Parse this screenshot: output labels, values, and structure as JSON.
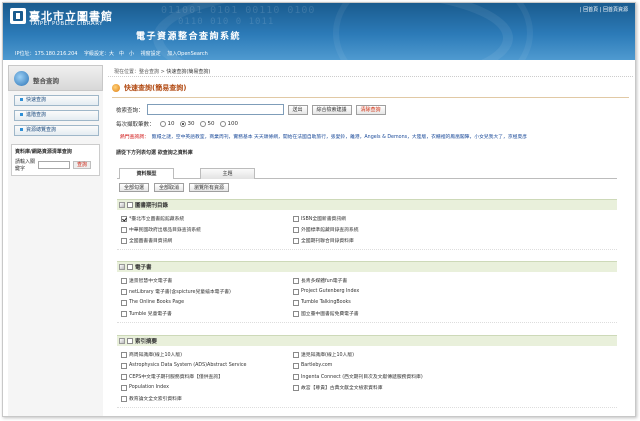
{
  "header": {
    "library_cn": "臺北市立圖書館",
    "library_en": "TAIPEI PUBLIC LIBRARY",
    "system_title": "電子資源整合查詢系統",
    "top_links": "| 回首頁 | 回首頁資源",
    "ip_label": "IP位址：175.180.216.204",
    "font_size": "字級設定：大　中　小",
    "resize": "視窗設定",
    "opensearch": "加入OpenSearch",
    "bg_digits": "011001 0101 00110 0100",
    "bg_digits2": "0110 010 0 1011"
  },
  "sidebar": {
    "title": "整合查詢",
    "items": [
      "快速查詢",
      "進階查詢",
      "資源總覽查詢"
    ],
    "box_title": "資料庫/網路資源清單查詢",
    "box_label": "請輸入關鍵字",
    "box_button": "查詢"
  },
  "main": {
    "breadcrumb_label": "現在位置：整合查詢 > ",
    "breadcrumb_current": "快速查詢(簡易查詢)",
    "section_title": "快速查詢(簡易查詢)",
    "search_label": "檢索查詢：",
    "btn_submit": "送出",
    "btn_suggest": "綜合檢索建議",
    "btn_clear": "清除查詢",
    "count_label": "每次擷取筆數：",
    "count_options": [
      "10",
      "30",
      "50",
      "100"
    ],
    "count_selected": "30",
    "hot_label": "熱門查詢詞：",
    "hot_words": "甄嬛之謎，空中英語教室，商業周刊，實務基本 天天頭條網，開始在法國自助旅行，張愛鈴，離港，Angels & Demons，大陸版，衣櫃裡的鳳凰閣陣，小女兒我大了，京極夏彥",
    "pick_label": "請從下方列表勾選 欲查詢之資料庫",
    "tabs": [
      "資料類型",
      "主題"
    ],
    "actions": [
      "全部勾選",
      "全部取消",
      "瀏覽所有資源"
    ]
  },
  "groups": [
    {
      "title": "圖書期刊目錄",
      "items": [
        {
          "label": "*臺北市立圖書館館藏系統",
          "checked": true
        },
        {
          "label": "ISBN全國新書資訊網",
          "checked": false
        },
        {
          "label": "中華民國政府出版品目錄查詢系統",
          "checked": false
        },
        {
          "label": "外國標準館藏目錄查詢系統",
          "checked": false
        },
        {
          "label": "全國圖書書目資訊網",
          "checked": false
        },
        {
          "label": "全國期刊聯合目錄資料庫",
          "checked": false
        }
      ]
    },
    {
      "title": "電子書",
      "items": [
        {
          "label": "遠景智慧中文電子書",
          "checked": false
        },
        {
          "label": "長青多媒體fun電子書",
          "checked": false
        },
        {
          "label": "netLibrary 電子書(含spicture兒童繪本電子書)",
          "checked": false
        },
        {
          "label": "Project Gutenberg Index",
          "checked": false
        },
        {
          "label": "The Online Books Page",
          "checked": false
        },
        {
          "label": "Tumble TalkingBooks",
          "checked": false
        },
        {
          "label": "Tumble 兒童電子書",
          "checked": false
        },
        {
          "label": "國立臺中圖書館免費電子書",
          "checked": false
        }
      ]
    },
    {
      "title": "索引摘要",
      "items": [
        {
          "label": "商周知識庫(線上10人版)",
          "checked": false
        },
        {
          "label": "遠見知識庫(線上10人版)",
          "checked": false
        },
        {
          "label": "Astrophysics Data System (ADS)Abstract Service",
          "checked": false
        },
        {
          "label": "Bartleby.com",
          "checked": false
        },
        {
          "label": "CEPS中文電子期刊服務資料庫【僅供查詢】",
          "checked": false
        },
        {
          "label": "Ingenta Connect (西文期刊目次及文獻傳遞服務資料庫)",
          "checked": false
        },
        {
          "label": "Population Index",
          "checked": false
        },
        {
          "label": "故宮【尊貴】古典文獻全文檢索資料庫",
          "checked": false
        },
        {
          "label": "教育論文全文索引資料庫",
          "checked": false
        }
      ]
    }
  ]
}
